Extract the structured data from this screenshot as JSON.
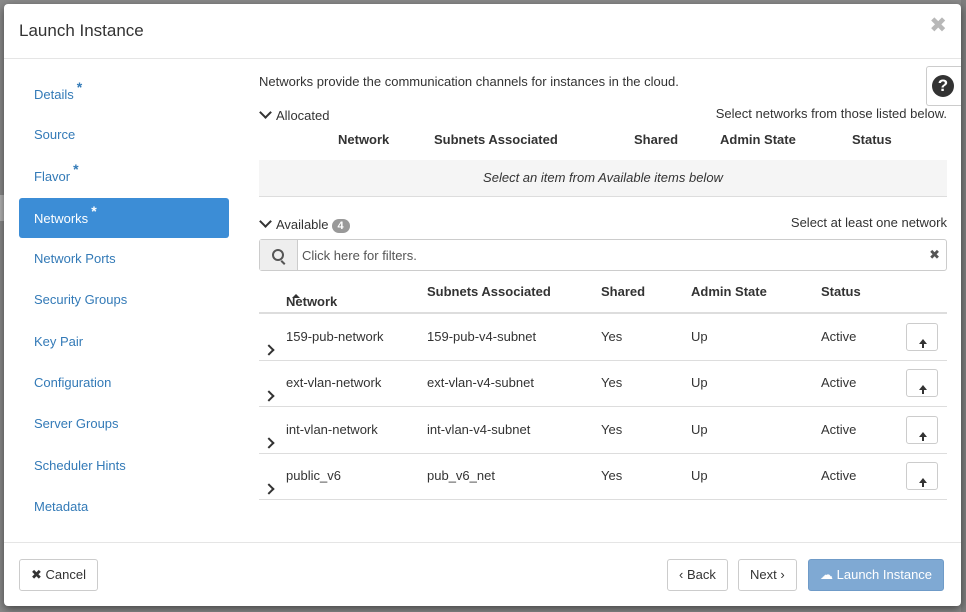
{
  "modal": {
    "title": "Launch Instance"
  },
  "nav": {
    "items": [
      {
        "label": "Details",
        "required": "*"
      },
      {
        "label": "Source"
      },
      {
        "label": "Flavor",
        "required": "*"
      },
      {
        "label": "Networks",
        "required": "*",
        "active": true
      },
      {
        "label": "Network Ports"
      },
      {
        "label": "Security Groups"
      },
      {
        "label": "Key Pair"
      },
      {
        "label": "Configuration"
      },
      {
        "label": "Server Groups"
      },
      {
        "label": "Scheduler Hints"
      },
      {
        "label": "Metadata"
      }
    ]
  },
  "content": {
    "intro": "Networks provide the communication channels for instances in the cloud.",
    "allocated": {
      "title": "Allocated",
      "hint": "Select networks from those listed below.",
      "columns": [
        "Network",
        "Subnets Associated",
        "Shared",
        "Admin State",
        "Status"
      ],
      "empty_text": "Select an item from Available items below"
    },
    "available": {
      "title": "Available",
      "count": "4",
      "hint": "Select at least one network",
      "filter_placeholder": "Click here for filters.",
      "clear_glyph": "✖",
      "columns": [
        "Network",
        "Subnets Associated",
        "Shared",
        "Admin State",
        "Status"
      ],
      "rows": [
        {
          "network": "159-pub-network",
          "subnets": "159-pub-v4-subnet",
          "shared": "Yes",
          "admin_state": "Up",
          "status": "Active"
        },
        {
          "network": "ext-vlan-network",
          "subnets": "ext-vlan-v4-subnet",
          "shared": "Yes",
          "admin_state": "Up",
          "status": "Active"
        },
        {
          "network": "int-vlan-network",
          "subnets": "int-vlan-v4-subnet",
          "shared": "Yes",
          "admin_state": "Up",
          "status": "Active"
        },
        {
          "network": "public_v6",
          "subnets": "pub_v6_net",
          "shared": "Yes",
          "admin_state": "Up",
          "status": "Active"
        }
      ]
    }
  },
  "footer": {
    "cancel": "Cancel",
    "back": "Back",
    "next": "Next",
    "launch": "Launch Instance"
  },
  "icons": {
    "close": "✖",
    "help": "?",
    "cancel": "✖"
  },
  "colors": {
    "active_nav": "#3c8dd6",
    "link": "#337ab7",
    "primary_disabled": "#7fa9d3"
  }
}
